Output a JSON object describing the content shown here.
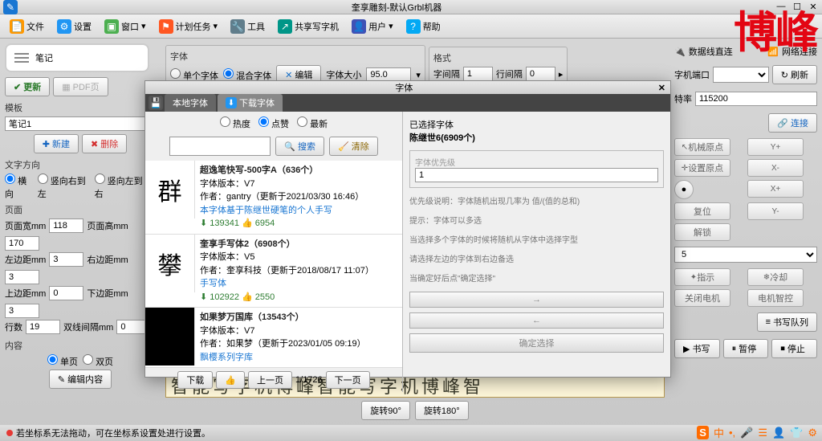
{
  "window": {
    "title": "奎享雕刻-默认Grbl机器"
  },
  "menu": {
    "file": "文件",
    "settings": "设置",
    "window": "窗口",
    "tasks": "计划任务",
    "tools": "工具",
    "share": "共享写字机",
    "user": "用户",
    "help": "帮助"
  },
  "logo": "博峰",
  "font_panel": {
    "title": "字体",
    "single": "单个字体",
    "mixed": "混合字体",
    "edit": "编辑",
    "size_label": "字体大小",
    "size": "95.0"
  },
  "format_panel": {
    "title": "格式",
    "wspace": "字间隔",
    "wspace_v": "1",
    "lspace": "行间隔",
    "lspace_v": "0"
  },
  "notes": {
    "label": "笔记",
    "update": "更新",
    "pdf": "PDF页"
  },
  "template": {
    "title": "模板",
    "value": "笔记1",
    "new": "新建",
    "del": "删除"
  },
  "direction": {
    "title": "文字方向",
    "h": "横向",
    "ltr": "竖向右到左",
    "rtl": "竖向左到右"
  },
  "page": {
    "title": "页面",
    "pw": "页面宽mm",
    "pw_v": "118",
    "ph": "页面高mm",
    "ph_v": "170",
    "ml": "左边距mm",
    "ml_v": "3",
    "mr": "右边距mm",
    "mr_v": "3",
    "mt": "上边距mm",
    "mt_v": "0",
    "mb": "下边距mm",
    "mb_v": "3",
    "lines": "行数",
    "lines_v": "19",
    "dls": "双线间隔mm",
    "dls_v": "0"
  },
  "content": {
    "title": "内容",
    "single": "单页",
    "double": "双页",
    "edit": "编辑内容"
  },
  "rotate": {
    "r90": "旋转90°",
    "r180": "旋转180°"
  },
  "canvas_text": "智能写字机博峰智能写字机博峰智",
  "status": "若坐标系无法拖动，可在坐标系设置处进行设置。",
  "right_panel": {
    "conn": "数据线直连",
    "net": "网络连接",
    "port_label": "字机端口",
    "refresh": "刷新",
    "baud_label": "特率",
    "baud": "115200",
    "connect": "连接",
    "mp": "机械原点",
    "sp": "设置原点",
    "reset": "复位",
    "lock": "解锁",
    "laser": "指示",
    "cool": "冷却",
    "motor": "关闭电机",
    "ectl": "电机智控",
    "queue": "书写队列",
    "write": "书写",
    "pause": "暂停",
    "stop": "停止"
  },
  "dialog": {
    "title": "字体",
    "tab_local": "本地字体",
    "tab_dl": "下载字体",
    "filter": {
      "hot": "热度",
      "like": "点赞",
      "new": "最新"
    },
    "search": "搜索",
    "clear": "清除",
    "download": "下载",
    "icon_btn": "",
    "prev": "上一页",
    "page": "1/1726",
    "next": "下一页",
    "selected_lbl": "已选择字体",
    "selected": "陈继世6(6909个)",
    "priority_lbl": "字体优先级",
    "priority_v": "1",
    "hint1": "优先级说明：字体随机出现几率为 值/(值的总和)",
    "hint2": "提示：字体可以多选",
    "hint3": "当选择多个字体的时候将随机从字体中选择字型",
    "hint4": "请选择左边的字体到右边备选",
    "hint5": "当确定好后点\"确定选择\"",
    "confirm": "确定选择",
    "fonts": [
      {
        "preview": "群",
        "title": "超逸笔快写-500字A（636个）",
        "ver": "字体版本：V7",
        "author": "作者：gantry（更新于2021/03/30 16:46）",
        "desc": "本字体基于陈继世硬笔的个人手写",
        "dl": "139341",
        "like": "6954"
      },
      {
        "preview": "攀",
        "title": "奎享手写体2（6908个）",
        "ver": "字体版本：V5",
        "author": "作者：奎享科技（更新于2018/08/17 11:07）",
        "desc": "手写体",
        "dl": "102922",
        "like": "2550"
      },
      {
        "preview": "",
        "dark": true,
        "title": "如果梦万国库（13543个）",
        "ver": "字体版本：V7",
        "author": "作者：如果梦（更新于2023/01/05 09:19）",
        "desc": "飘樱系列字库",
        "dl": "",
        "like": ""
      }
    ]
  }
}
